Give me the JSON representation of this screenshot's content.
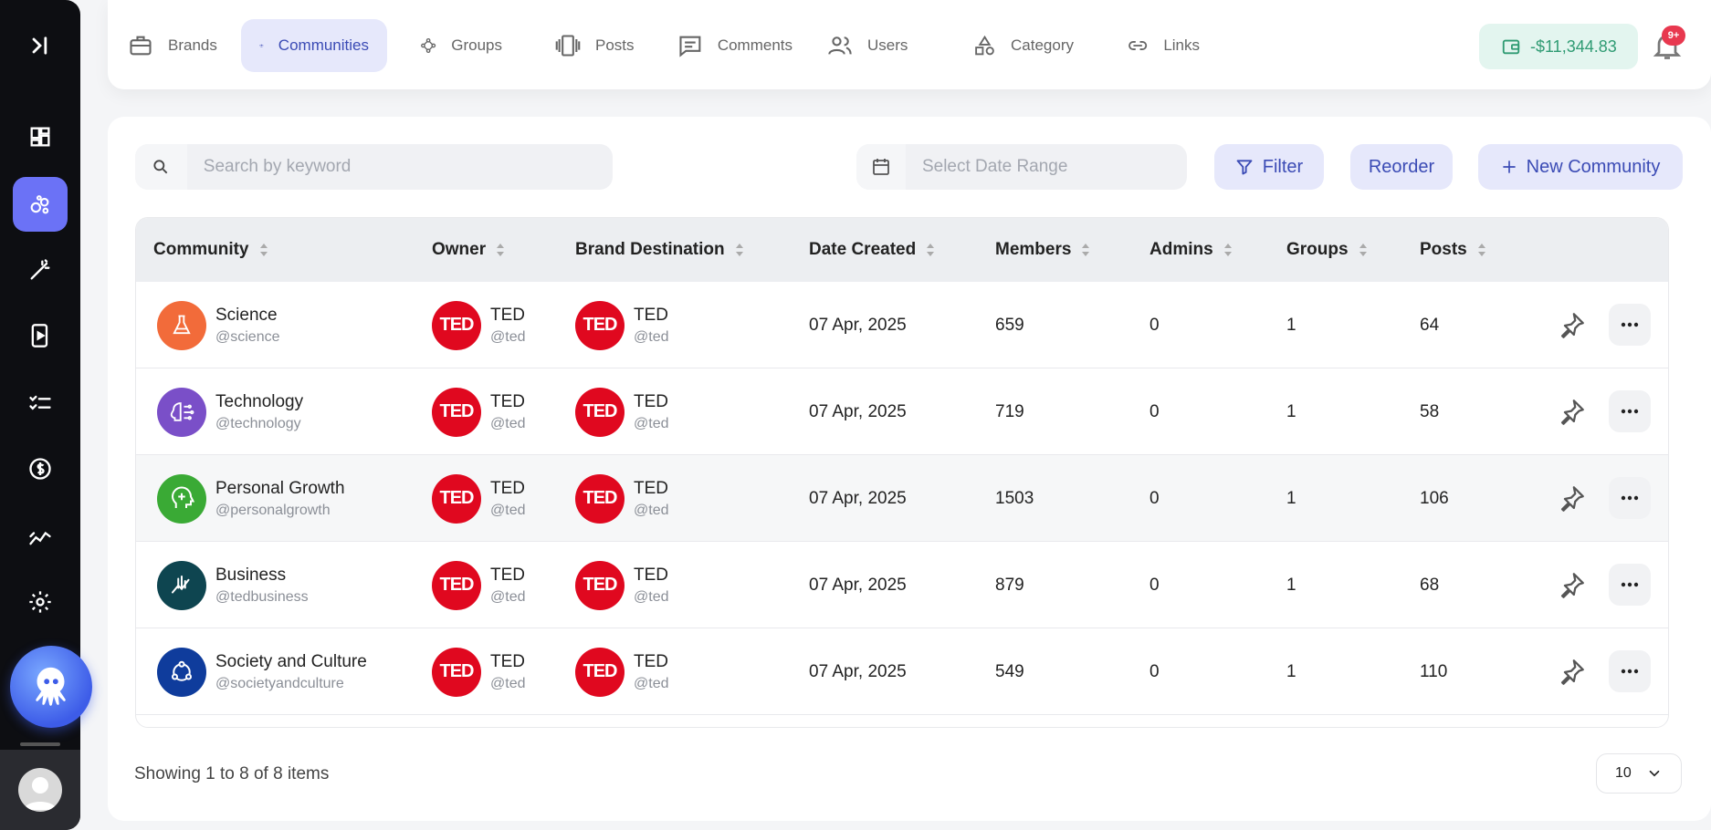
{
  "nav": {
    "items": [
      {
        "label": "Brands",
        "icon": "briefcase-icon",
        "active": false
      },
      {
        "label": "Communities",
        "icon": "users-group-icon",
        "active": true
      },
      {
        "label": "Groups",
        "icon": "group-nodes-icon",
        "active": false
      },
      {
        "label": "Posts",
        "icon": "posts-icon",
        "active": false
      },
      {
        "label": "Comments",
        "icon": "comment-icon",
        "active": false
      },
      {
        "label": "Users",
        "icon": "user-icon",
        "active": false
      },
      {
        "label": "Category",
        "icon": "shapes-icon",
        "active": false
      },
      {
        "label": "Links",
        "icon": "link-icon",
        "active": false
      }
    ],
    "wallet_balance": "-$11,344.83",
    "notification_badge": "9+"
  },
  "sidebar": {
    "icons": [
      "expand-icon",
      "dashboard-icon",
      "communities-icon",
      "magic-wand-icon",
      "media-icon",
      "tasks-icon",
      "dollar-icon",
      "analytics-icon",
      "settings-icon"
    ]
  },
  "toolbar": {
    "search_placeholder": "Search by keyword",
    "date_placeholder": "Select Date Range",
    "filter_label": "Filter",
    "reorder_label": "Reorder",
    "new_label": "New Community"
  },
  "table": {
    "columns": [
      "Community",
      "Owner",
      "Brand Destination",
      "Date Created",
      "Members",
      "Admins",
      "Groups",
      "Posts"
    ],
    "rows": [
      {
        "name": "Science",
        "handle": "@science",
        "color": "#f26b3a",
        "owner": "TED",
        "owner_handle": "@ted",
        "brand": "TED",
        "brand_handle": "@ted",
        "date": "07 Apr, 2025",
        "members": "659",
        "admins": "0",
        "groups": "1",
        "posts": "64"
      },
      {
        "name": "Technology",
        "handle": "@technology",
        "color": "#7a4fc8",
        "owner": "TED",
        "owner_handle": "@ted",
        "brand": "TED",
        "brand_handle": "@ted",
        "date": "07 Apr, 2025",
        "members": "719",
        "admins": "0",
        "groups": "1",
        "posts": "58"
      },
      {
        "name": "Personal Growth",
        "handle": "@personalgrowth",
        "color": "#3aaa35",
        "owner": "TED",
        "owner_handle": "@ted",
        "brand": "TED",
        "brand_handle": "@ted",
        "date": "07 Apr, 2025",
        "members": "1503",
        "admins": "0",
        "groups": "1",
        "posts": "106"
      },
      {
        "name": "Business",
        "handle": "@tedbusiness",
        "color": "#0e4550",
        "owner": "TED",
        "owner_handle": "@ted",
        "brand": "TED",
        "brand_handle": "@ted",
        "date": "07 Apr, 2025",
        "members": "879",
        "admins": "0",
        "groups": "1",
        "posts": "68"
      },
      {
        "name": "Society and Culture",
        "handle": "@societyandculture",
        "color": "#0f3c9c",
        "owner": "TED",
        "owner_handle": "@ted",
        "brand": "TED",
        "brand_handle": "@ted",
        "date": "07 Apr, 2025",
        "members": "549",
        "admins": "0",
        "groups": "1",
        "posts": "110"
      }
    ]
  },
  "footer": {
    "showing": "Showing 1 to 8 of 8 items",
    "per_page": "10"
  }
}
